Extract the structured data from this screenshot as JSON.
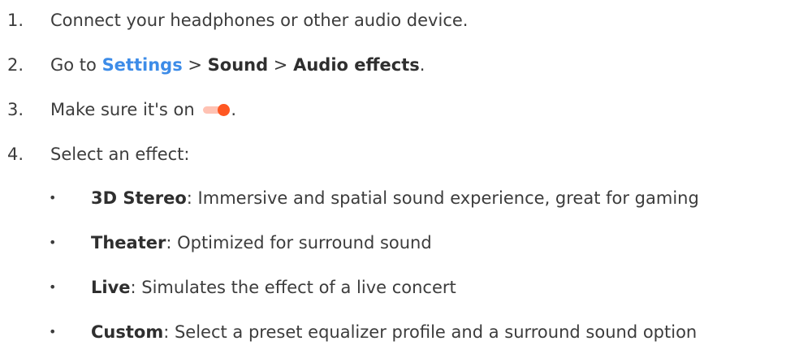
{
  "steps": [
    {
      "num": "1.",
      "text": "Connect your headphones or other audio device."
    },
    {
      "num": "2.",
      "prefix": "Go to ",
      "link": "Settings",
      "sep1": " > ",
      "bold1": "Sound",
      "sep2": " > ",
      "bold2": "Audio effects",
      "suffix": "."
    },
    {
      "num": "3.",
      "text": "Make sure it's on ",
      "suffix": "."
    },
    {
      "num": "4.",
      "text": "Select an effect:"
    }
  ],
  "effects": [
    {
      "name": "3D Stereo",
      "description": ": Immersive and spatial sound experience, great for gaming"
    },
    {
      "name": "Theater",
      "description": ": Optimized for surround sound"
    },
    {
      "name": "Live",
      "description": ": Simulates the effect of a live concert"
    },
    {
      "name": "Custom",
      "description": ": Select a preset equalizer profile and a surround sound option"
    }
  ],
  "bullet_char": "•",
  "colors": {
    "link": "#3d8ce8",
    "toggle_thumb": "#ff5722",
    "toggle_track": "#ffc2b3",
    "text": "#3c3c3c"
  },
  "toggle_state": "on"
}
